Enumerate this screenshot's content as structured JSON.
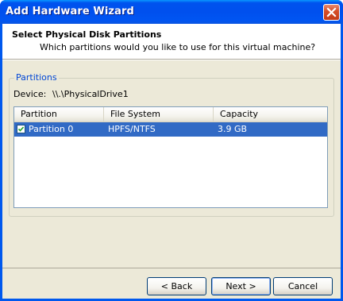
{
  "window": {
    "title": "Add Hardware Wizard",
    "close_icon": "close-icon"
  },
  "header": {
    "title": "Select Physical Disk Partitions",
    "subtitle": "Which partitions would you like to use for this virtual machine?"
  },
  "partitions_group": {
    "label": "Partitions",
    "device_label": "Device:",
    "device_value": "\\\\.\\PhysicalDrive1",
    "columns": [
      "Partition",
      "File System",
      "Capacity"
    ],
    "rows": [
      {
        "checked": true,
        "partition": "Partition 0",
        "file_system": "HPFS/NTFS",
        "capacity": "3.9 GB"
      }
    ]
  },
  "buttons": {
    "back": "< Back",
    "next": "Next >",
    "cancel": "Cancel"
  },
  "colors": {
    "titlebar": "#0053ee",
    "selection": "#316ac5",
    "group_label": "#0046d5",
    "dialog_bg": "#ece9d8"
  }
}
